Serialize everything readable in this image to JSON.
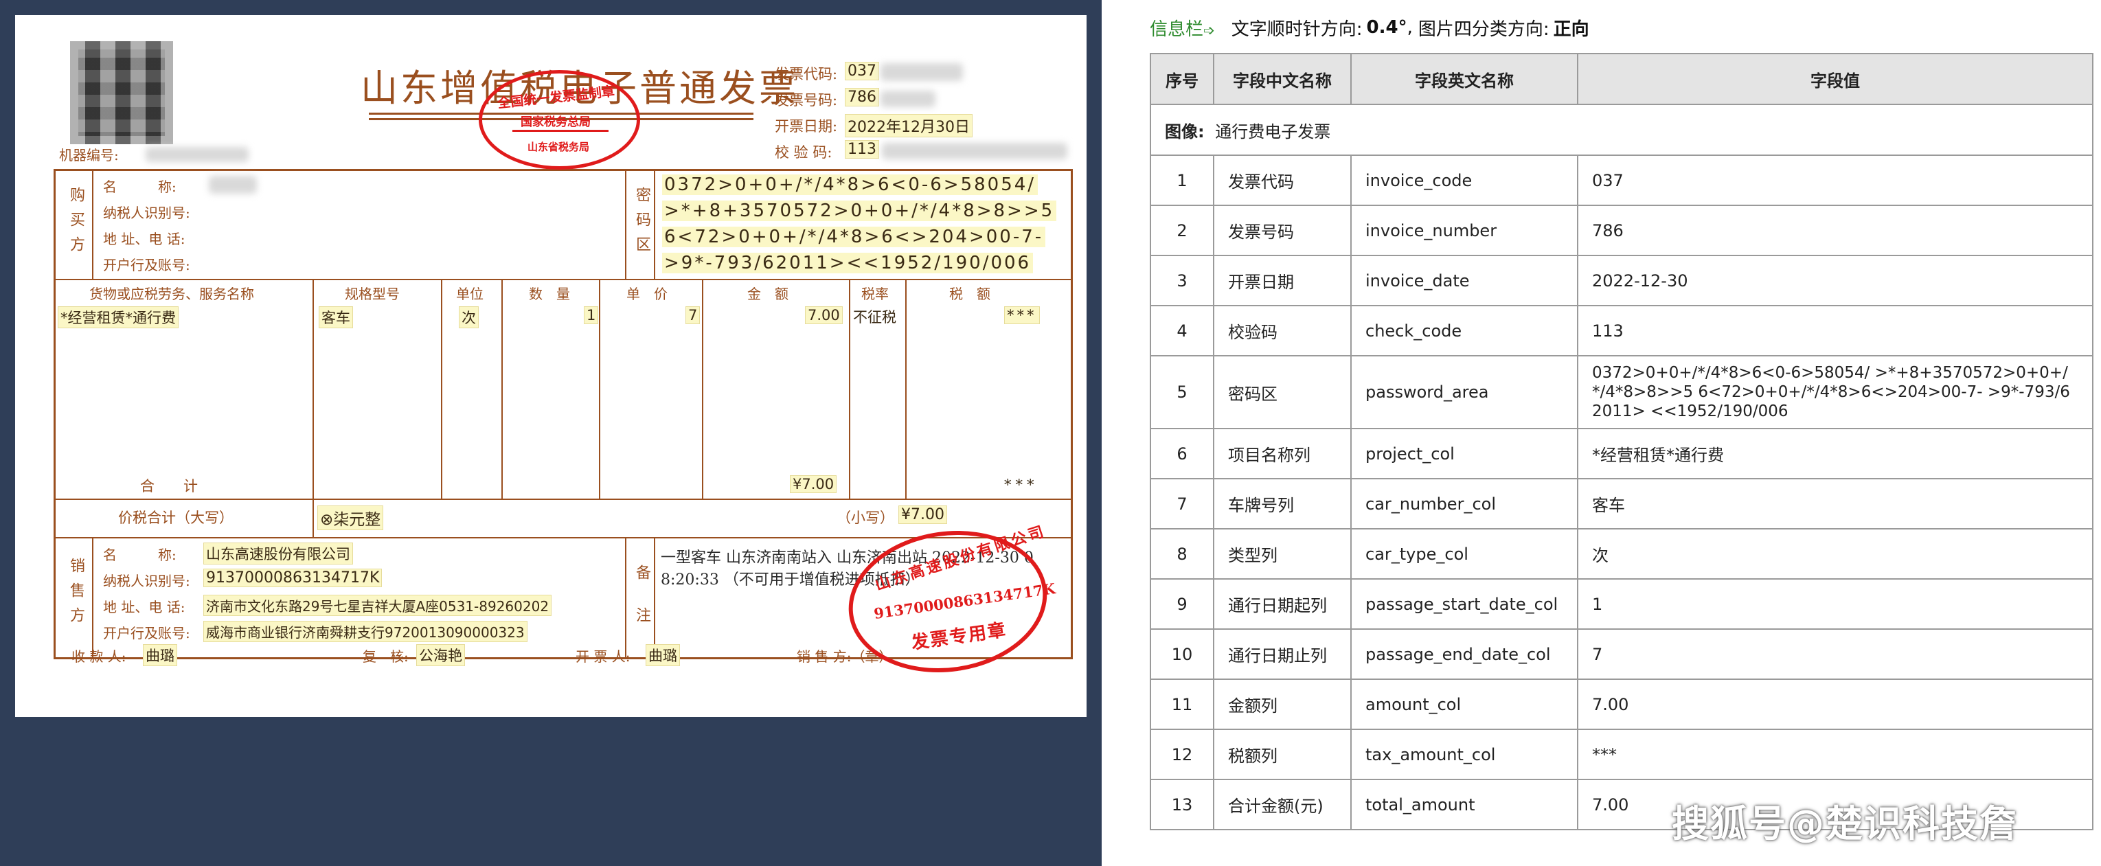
{
  "invoice": {
    "title": "山东增值税电子普通发票",
    "machine_no_label": "机器编号:",
    "code_label": "发票代码:",
    "code_value": "037",
    "number_label": "发票号码:",
    "number_value": "786",
    "date_label": "开票日期:",
    "date_value": "2022年12月30日",
    "check_label": "校 验 码:",
    "check_value": "113",
    "buyer_side": "购买方",
    "buyer_name_label": "名　　　称:",
    "buyer_tax_label": "纳税人识别号:",
    "buyer_addr_label": "地 址、电 话:",
    "buyer_bank_label": "开户行及账号:",
    "pwd_side": "密码区",
    "pwd_lines": [
      "0372>0+0+/*/4*8>6<0-6>58054/",
      ">*+8+3570572>0+0+/*/4*8>8>>5",
      "6<72>0+0+/*/4*8>6<>204>00-7-",
      ">9*-793/62011><<1952/190/006"
    ],
    "col_item": "货物或应税劳务、服务名称",
    "col_spec": "规格型号",
    "col_unit": "单位",
    "col_qty": "数　量",
    "col_price": "单　价",
    "col_amount": "金　额",
    "col_rate": "税率",
    "col_tax": "税　额",
    "row_item": "*经营租赁*通行费",
    "row_spec": "客车",
    "row_unit": "次",
    "row_qty": "1",
    "row_price": "7",
    "row_amount": "7.00",
    "row_rate": "不征税",
    "row_tax": "***",
    "total_label": "合　　计",
    "total_amount": "¥7.00",
    "total_tax": "***",
    "sum_words_label": "价税合计（大写）",
    "sum_words_value": "⊗柒元整",
    "sum_small_label": "（小写）",
    "sum_small_value": "¥7.00",
    "seller_side": "销售方",
    "seller_name_label": "名　　　称:",
    "seller_name": "山东高速股份有限公司",
    "seller_tax_label": "纳税人识别号:",
    "seller_tax": "91370000863134717K",
    "seller_addr_label": "地 址、电 话:",
    "seller_addr": "济南市文化东路29号七星吉祥大厦A座0531-89260202",
    "seller_bank_label": "开户行及账号:",
    "seller_bank": "威海市商业银行济南舜耕支行9720013090000323",
    "remark_side": "备注",
    "remark_line1": "一型客车 山东济南南站入 山东济南出站 2022-12-30 0",
    "remark_line2": "8:20:33 （不可用于增值税进项抵扣）",
    "payee_label": "收 款 人:",
    "payee": "曲璐",
    "reviewer_label": "复　核:",
    "reviewer": "公海艳",
    "issuer_label": "开 票 人:",
    "issuer": "曲璐",
    "seller_seal_label": "销 售 方:（章）",
    "stamp_top_text": "全国统一发票监制章",
    "stamp_top_sub": "国家税务总局",
    "stamp_top_bottom": "山东省税务局",
    "stamp_seller_company": "山东高速股份有限公司",
    "stamp_seller_tax": "91370000863134717K",
    "stamp_seller_bottom": "发票专用章"
  },
  "info_bar": {
    "label": "信息栏",
    "label_icon": "arrow-right-icon",
    "rotation_text": "文字顺时针方向:",
    "rotation_value": "0.4°",
    "sep": ",",
    "orient_text": "图片四分类方向:",
    "orient_value": "正向"
  },
  "table": {
    "headers": [
      "序号",
      "字段中文名称",
      "字段英文名称",
      "字段值"
    ],
    "section_label": "图像:",
    "section_value": "通行费电子发票",
    "rows": [
      {
        "no": "1",
        "cn": "发票代码",
        "en": "invoice_code",
        "val": "037"
      },
      {
        "no": "2",
        "cn": "发票号码",
        "en": "invoice_number",
        "val": "786"
      },
      {
        "no": "3",
        "cn": "开票日期",
        "en": "invoice_date",
        "val": "2022-12-30"
      },
      {
        "no": "4",
        "cn": "校验码",
        "en": "check_code",
        "val": "113"
      },
      {
        "no": "5",
        "cn": "密码区",
        "en": "password_area",
        "val": "0372>0+0+/*/4*8>6<0-6>58054/ >*+8+3570572>0+0+/*/4*8>8>>5 6<72>0+0+/*/4*8>6<>204>00-7- >9*-793/62011> <<1952/190/006"
      },
      {
        "no": "6",
        "cn": "项目名称列",
        "en": "project_col",
        "val": "*经营租赁*通行费"
      },
      {
        "no": "7",
        "cn": "车牌号列",
        "en": "car_number_col",
        "val": "客车"
      },
      {
        "no": "8",
        "cn": "类型列",
        "en": "car_type_col",
        "val": "次"
      },
      {
        "no": "9",
        "cn": "通行日期起列",
        "en": "passage_start_date_col",
        "val": "1"
      },
      {
        "no": "10",
        "cn": "通行日期止列",
        "en": "passage_end_date_col",
        "val": "7"
      },
      {
        "no": "11",
        "cn": "金额列",
        "en": "amount_col",
        "val": "7.00"
      },
      {
        "no": "12",
        "cn": "税额列",
        "en": "tax_amount_col",
        "val": "***"
      },
      {
        "no": "13",
        "cn": "合计金额(元)",
        "en": "total_amount",
        "val": "7.00"
      }
    ]
  },
  "watermark": "搜狐号@楚识科技詹"
}
